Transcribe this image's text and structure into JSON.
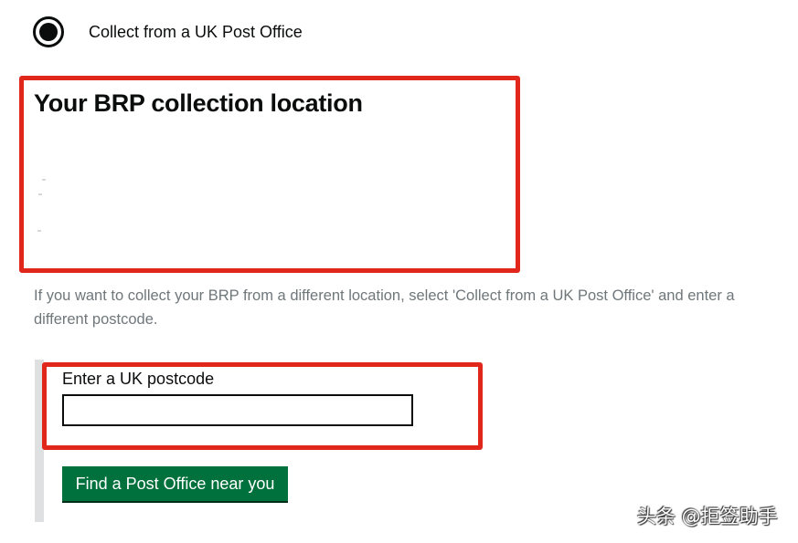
{
  "radio_option": {
    "label": "Collect from a UK Post Office",
    "selected": true
  },
  "collection_location": {
    "heading": "Your BRP collection location"
  },
  "hint": {
    "text": "If you want to collect your BRP from a different location, select 'Collect from a UK Post Office' and enter a different postcode."
  },
  "postcode": {
    "label": "Enter a UK postcode",
    "value": ""
  },
  "find_button": {
    "label": "Find a Post Office near you"
  },
  "watermark": {
    "text": "头条 @拒签助手"
  },
  "colors": {
    "annotation_red": "#e1261c",
    "button_green": "#00703c",
    "hint_grey": "#6f777b",
    "panel_bar_grey": "#dee0e2"
  }
}
